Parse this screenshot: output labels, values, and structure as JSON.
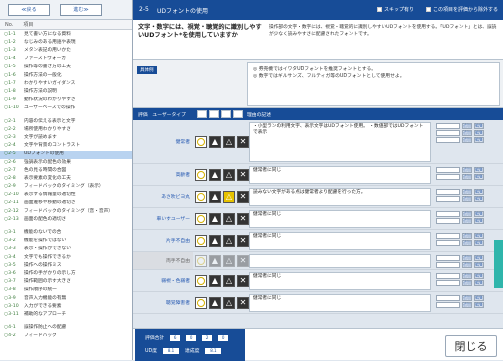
{
  "sidebar": {
    "buttons": [
      "≪戻る",
      "進む≫"
    ],
    "list_header": [
      "No.",
      "項目"
    ],
    "items": [
      {
        "code": "○1-1",
        "text": "見て書い方になる資料"
      },
      {
        "code": "○1-2",
        "text": "なじみのある用語や表現"
      },
      {
        "code": "○1-3",
        "text": "メタン表記の用いかた"
      },
      {
        "code": "○1-4",
        "text": "ファーストヴォーカ"
      },
      {
        "code": "○1-5",
        "text": "操作等の書き方の工夫"
      },
      {
        "code": "○1-6",
        "text": "操作方法の一般化"
      },
      {
        "code": "○1-7",
        "text": "わかりやすいガイダンス"
      },
      {
        "code": "○1-8",
        "text": "操作方法の説明"
      },
      {
        "code": "○1-9",
        "text": "動作状況のわかりやすさ"
      },
      {
        "code": "○1-10",
        "text": "ユーザーベースでの操作"
      },
      {
        "code": "",
        "text": ""
      },
      {
        "code": "○2-1",
        "text": "内容の伝える表示と文字"
      },
      {
        "code": "○2-2",
        "text": "場所使用わかりやすさ"
      },
      {
        "code": "○2-3",
        "text": "文字が読めます"
      },
      {
        "code": "○2-4",
        "text": "文字や背景のコントラスト"
      },
      {
        "code": "○2-5",
        "text": "UDフォントの使用"
      },
      {
        "code": "○2-6",
        "text": "強調表示の配色の効果"
      },
      {
        "code": "○2-7",
        "text": "色の見る時間の合図"
      },
      {
        "code": "○2-8",
        "text": "表示要素の変化の工夫"
      },
      {
        "code": "○2-9",
        "text": "フィードバックのタイミング（表示）"
      },
      {
        "code": "○2-10",
        "text": "表示する情報量の適切性"
      },
      {
        "code": "○2-11",
        "text": "画面遷移や移動の適切さ"
      },
      {
        "code": "○2-12",
        "text": "フィードバックのタイミング（音・音声）"
      },
      {
        "code": "○2-13",
        "text": "画面の配色の適切さ"
      },
      {
        "code": "",
        "text": ""
      },
      {
        "code": "○3-1",
        "text": "機能のないでの合"
      },
      {
        "code": "○3-2",
        "text": "機能を操作ではない"
      },
      {
        "code": "○3-3",
        "text": "表示・操作ができない"
      },
      {
        "code": "○3-4",
        "text": "文字でも操作できるか"
      },
      {
        "code": "○3-5",
        "text": "操作への操作ミス"
      },
      {
        "code": "○3-6",
        "text": "操作の手がかりの示し方"
      },
      {
        "code": "○3-7",
        "text": "操作範囲の示す大きさ"
      },
      {
        "code": "○3-8",
        "text": "操作順序の統一"
      },
      {
        "code": "○3-9",
        "text": "音声入力機能の有無"
      },
      {
        "code": "○3-10",
        "text": "入力ができる要素"
      },
      {
        "code": "○3-11",
        "text": "補助的なアプローチ"
      },
      {
        "code": "",
        "text": ""
      },
      {
        "code": "○4-1",
        "text": "誤操作防止への配慮"
      },
      {
        "code": "○4-2",
        "text": "フィードバック"
      }
    ]
  },
  "header": {
    "number": "2-5",
    "title": "UDフォントの使用",
    "check1": "スキップ有り",
    "check2": "この項目を評価から除外する"
  },
  "question": {
    "main": "文字・数字には、視覚・聴覚的に識別しやすいUDフォント*を使用していますか",
    "note": "操作部の文字・数字には、視覚・聴覚的に識別しやすいUDフォントを使用する。「UDフォント」とは、誤読が少なく読みやすさに配慮されたフォントです。"
  },
  "example": {
    "label": "具体例",
    "lines": [
      "◎ 券売機ではイワタUDフォントを推奨フォントとする。",
      "◎ 数字ではギルサンズ、フルティガ等のUDフォントとして使用せよ。"
    ]
  },
  "gridhead": {
    "left": "評価　ユーザータイプ",
    "right": "理由の記述"
  },
  "rows": [
    {
      "label": "健常者",
      "comment": "・小型ランの利用文字、表示文字はUDフォント使用。\n・数値部ではUDフォントで表示",
      "gray": false
    },
    {
      "label": "高齢者",
      "comment": "健常者に同じ",
      "gray": false
    },
    {
      "label": "あさ吹ビヨ丸",
      "comment": "読みない文字がある点は健常者より配慮を行った方。",
      "gray": false
    },
    {
      "label": "車いすユーザー",
      "comment": "健常者に同じ",
      "gray": false
    },
    {
      "label": "片手不自由",
      "comment": "健常者に同じ",
      "gray": false
    },
    {
      "label": "両手不自由",
      "comment": "",
      "gray": true
    },
    {
      "label": "弱視・色弱者",
      "comment": "健常者に同じ",
      "gray": false
    },
    {
      "label": "聴覚障害者",
      "comment": "健常者に同じ",
      "gray": false
    }
  ],
  "controls": {
    "btn_a": "追加",
    "btn_b": "削除",
    "btn_c": "編集"
  },
  "footer": {
    "label1": "評価合計",
    "nums1": [
      "6",
      "0",
      "2",
      "0"
    ],
    "label2": "UD度",
    "val2": "8.1",
    "label3": "達成度",
    "val3": "8.1",
    "close": "閉じる"
  }
}
